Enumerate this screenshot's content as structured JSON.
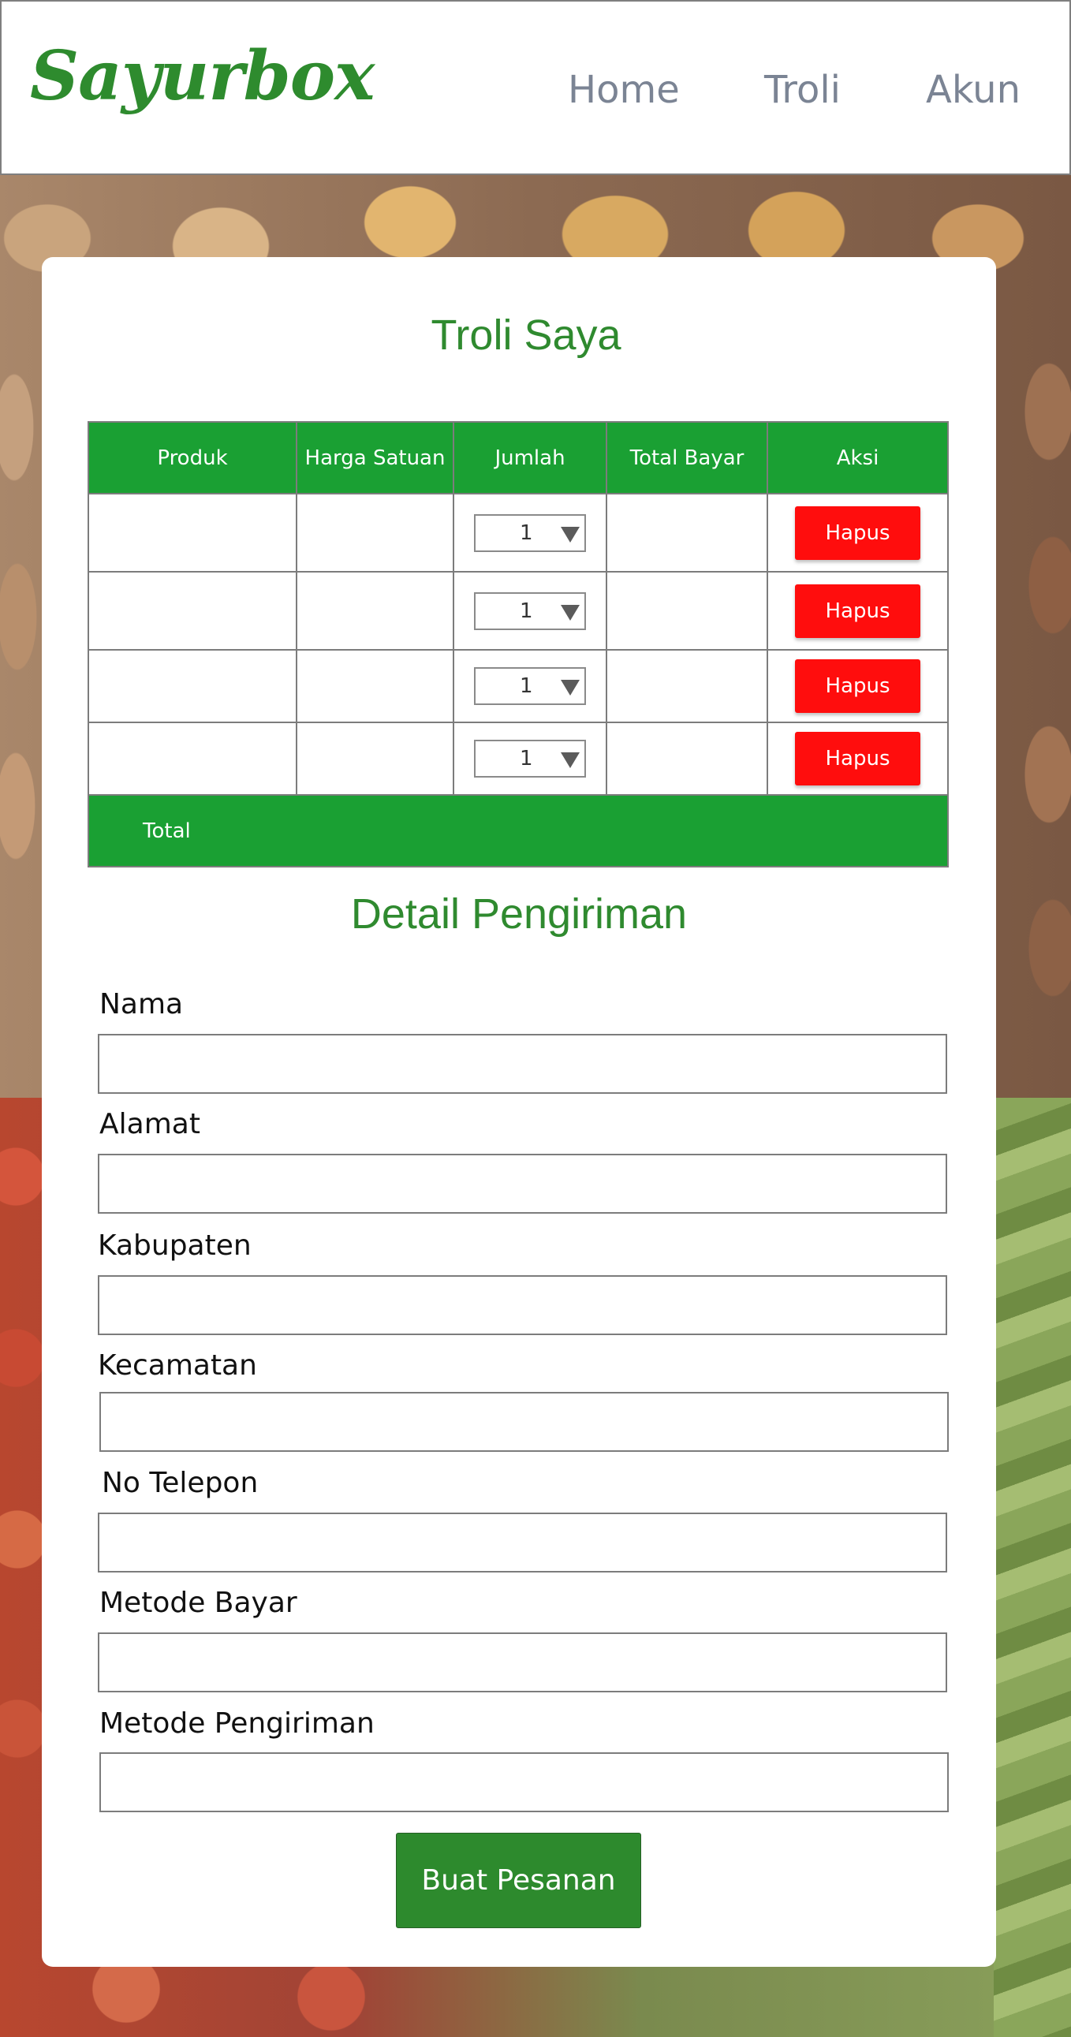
{
  "header": {
    "logo": "Sayurbox",
    "nav": [
      {
        "label": "Home"
      },
      {
        "label": "Troli"
      },
      {
        "label": "Akun"
      }
    ]
  },
  "cart": {
    "title": "Troli Saya",
    "columns": [
      "Produk",
      "Harga Satuan",
      "Jumlah",
      "Total Bayar",
      "Aksi"
    ],
    "rows": [
      {
        "produk": "",
        "harga": "",
        "jumlah": "1",
        "total": "",
        "aksi": "Hapus"
      },
      {
        "produk": "",
        "harga": "",
        "jumlah": "1",
        "total": "",
        "aksi": "Hapus"
      },
      {
        "produk": "",
        "harga": "",
        "jumlah": "1",
        "total": "",
        "aksi": "Hapus"
      },
      {
        "produk": "",
        "harga": "",
        "jumlah": "1",
        "total": "",
        "aksi": "Hapus"
      }
    ],
    "total_label": "Total"
  },
  "shipping": {
    "title": "Detail Pengiriman",
    "fields": [
      {
        "label": "Nama",
        "value": ""
      },
      {
        "label": "Alamat",
        "value": ""
      },
      {
        "label": "Kabupaten",
        "value": ""
      },
      {
        "label": "Kecamatan",
        "value": ""
      },
      {
        "label": "No Telepon",
        "value": ""
      },
      {
        "label": "Metode Bayar",
        "value": ""
      },
      {
        "label": "Metode Pengiriman",
        "value": ""
      }
    ],
    "submit_label": "Buat Pesanan"
  },
  "colors": {
    "brand_green": "#2f8a2f",
    "table_green": "#1aa033",
    "delete_red": "#ff0d0d",
    "nav_gray": "#7b8494"
  }
}
